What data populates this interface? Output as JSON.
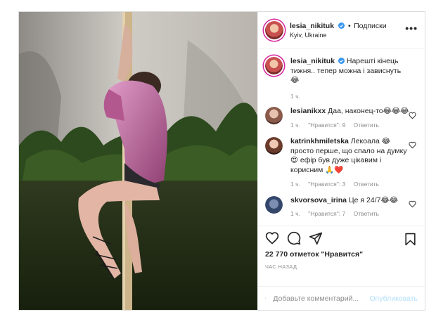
{
  "post": {
    "header": {
      "username": "lesia_nikituk",
      "separator": "•",
      "follow_label": "Подписки",
      "location": "Kyiv, Ukraine",
      "more_label": "•••"
    },
    "caption": {
      "username": "lesia_nikituk",
      "text": "Нарешті кінець тижня.. тепер можна і зависнуть 😂",
      "time": "1 ч."
    },
    "comments": [
      {
        "username": "lesianikxx",
        "text": "Даа, наконец-то😂😂😂",
        "time": "1 ч.",
        "likes": "\"Нравится\": 9",
        "reply": "Ответить"
      },
      {
        "username": "katrinkhmiletska",
        "text": "Лекоала 😂 просто перше, що спало на думку 😍 ефір був дуже цікавим і корисним 🙏❤️",
        "time": "1 ч.",
        "likes": "\"Нравится\": 3",
        "reply": "Ответить"
      },
      {
        "username": "skvorsova_irina",
        "text": "Це я 24/7😂😂",
        "time": "1 ч.",
        "likes": "\"Нравится\": 7",
        "reply": "Ответить"
      }
    ],
    "likes_text": "22 770 отметок \"Нравится\"",
    "posted_time": "ЧАС НАЗАД",
    "add_comment": {
      "placeholder": "Добавьте комментарий...",
      "publish_label": "Опубликовать"
    },
    "icons": [
      "heart-icon",
      "comment-icon",
      "share-icon",
      "bookmark-icon",
      "emoji-icon",
      "verified-icon"
    ],
    "colors": {
      "verified": "#3897f0",
      "link_disabled": "#b2dffc",
      "muted": "#8e8e8e",
      "heart_outline": "#262626",
      "photo_jacket": "#c46aa0"
    }
  }
}
